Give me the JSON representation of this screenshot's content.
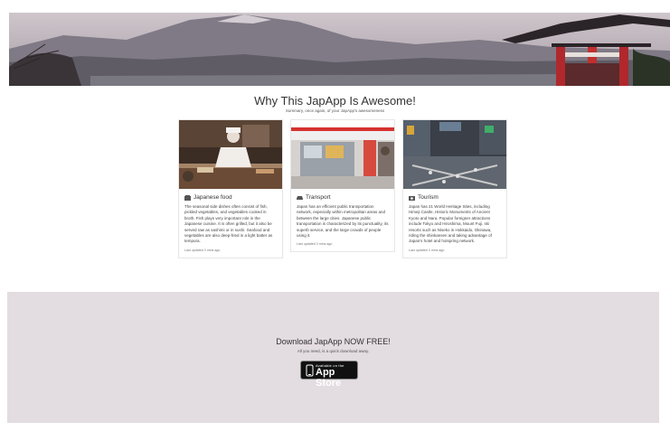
{
  "hero": {
    "alt": "Mount Fuji landscape with pagoda"
  },
  "section": {
    "title": "Why This JapApp Is Awesome!",
    "subtitle": "Summary, once again, of your JapApp's awesomeness"
  },
  "cards": [
    {
      "icon": "restaurant-icon",
      "title": "Japanese food",
      "text": "The seasonal side dishes often consist of fish, pickled vegetables, and vegetables cooked in broth. Fish plays very important role in the Japanese cuisine. It is often grilled, but it also be served raw as sashimi or in sushi. Seafood and vegetables are also deep-fried in a light batter as tempura.",
      "meta": "Last updated 3 mins ago"
    },
    {
      "icon": "car-icon",
      "title": "Transport",
      "text": "Japan has an efficient public transportation network, especially within metropolitan areas and between the large cities. Japanese public transportation is characterized by its punctuality, its superb service, and the large crowds of people using it.",
      "meta": "Last updated 3 mins ago"
    },
    {
      "icon": "camera-icon",
      "title": "Tourism",
      "text": "Japan has 21 World Heritage Sites, including Himeji Castle, Historic Monuments of Ancient Kyoto and Nara. Popular foreigner attractions include Tokyo and Hiroshima, Mount Fuji, ski resorts such as Niseko in Hokkaido, Okinawa, riding the shinkansen and taking advantage of Japan's hotel and hotspring network.",
      "meta": "Last updated 3 mins ago"
    }
  ],
  "download": {
    "title": "Download JapApp NOW FREE!",
    "subtitle": "All you need, is a quick download away.",
    "badge_small": "Available on the",
    "badge_big": "App Store"
  }
}
